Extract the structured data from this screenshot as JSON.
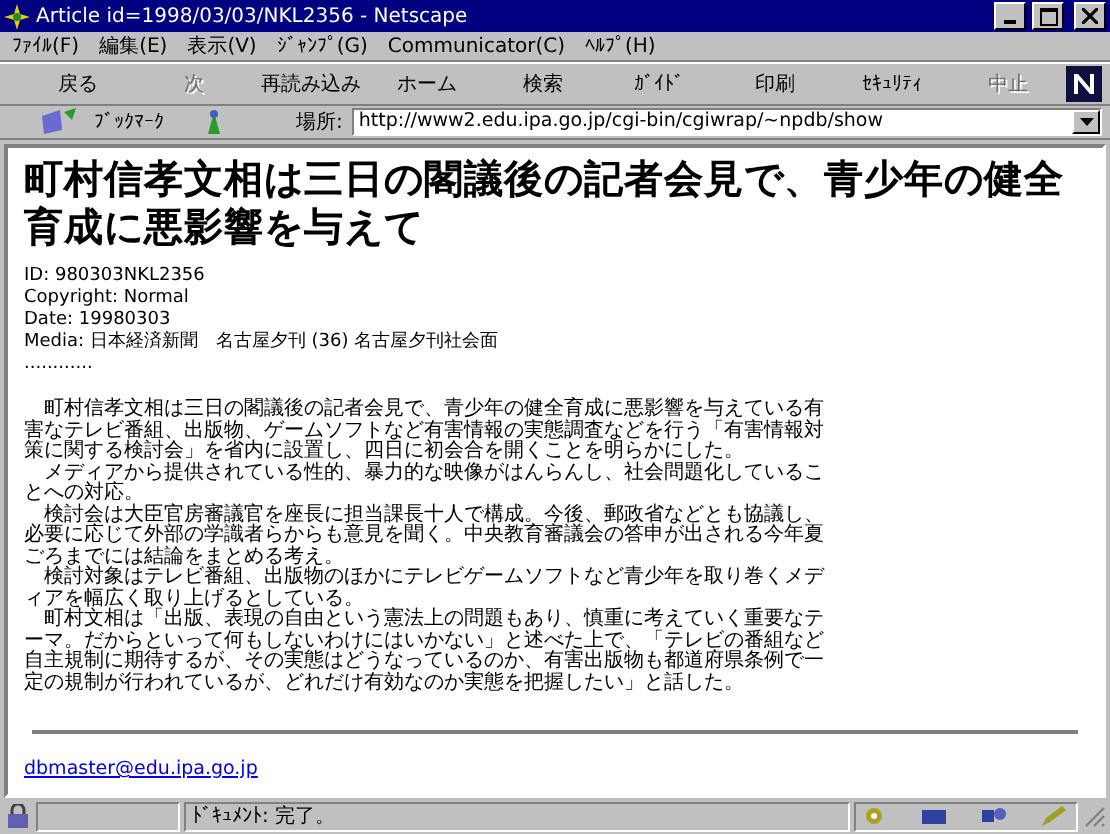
{
  "window": {
    "title": "Article id=1998/03/03/NKL2356 - Netscape"
  },
  "menu": [
    "ﾌｧｲﾙ(F)",
    "編集(E)",
    "表示(V)",
    "ｼﾞｬﾝﾌﾟ(G)",
    "Communicator(C)",
    "ﾍﾙﾌﾟ(H)"
  ],
  "toolbar": [
    {
      "label": "戻る",
      "disabled": false
    },
    {
      "label": "次",
      "disabled": true
    },
    {
      "label": "再読み込み",
      "disabled": false
    },
    {
      "label": "ホーム",
      "disabled": false
    },
    {
      "label": "検索",
      "disabled": false
    },
    {
      "label": "ｶﾞｲﾄﾞ",
      "disabled": false
    },
    {
      "label": "印刷",
      "disabled": false
    },
    {
      "label": "ｾｷｭﾘﾃｨ",
      "disabled": false
    },
    {
      "label": "中止",
      "disabled": true
    }
  ],
  "location_bar": {
    "bookmarks_label": "ﾌﾞｯｸﾏｰｸ",
    "location_label": "場所:",
    "url": "http://www2.edu.ipa.go.jp/cgi-bin/cgiwrap/~npdb/show"
  },
  "article": {
    "title": "町村信孝文相は三日の閣議後の記者会見で、青少年の健全育成に悪影響を与えて",
    "meta": [
      "ID: 980303NKL2356",
      "Copyright: Normal",
      "Date: 19980303",
      "Media: 日本経済新聞　名古屋夕刊 (36) 名古屋夕刊社会面",
      "............"
    ],
    "body_lines": [
      "　町村信孝文相は三日の閣議後の記者会見で、青少年の健全育成に悪影響を与えている有",
      "害なテレビ番組、出版物、ゲームソフトなど有害情報の実態調査などを行う「有害情報対",
      "策に関する検討会」を省内に設置し、四日に初会合を開くことを明らかにした。",
      "　メディアから提供されている性的、暴力的な映像がはんらんし、社会問題化しているこ",
      "とへの対応。",
      "　検討会は大臣官房審議官を座長に担当課長十人で構成。今後、郵政省などとも協議し、",
      "必要に応じて外部の学識者らからも意見を聞く。中央教育審議会の答申が出される今年夏",
      "ごろまでには結論をまとめる考え。",
      "　検討対象はテレビ番組、出版物のほかにテレビゲームソフトなど青少年を取り巻くメデ",
      "ィアを幅広く取り上げるとしている。",
      "　町村文相は「出版、表現の自由という憲法上の問題もあり、慎重に考えていく重要なテ",
      "ーマ。だからといって何もしないわけにはいかない」と述べた上で、「テレビの番組など",
      "自主規制に期待するが、その実態はどうなっているのか、有害出版物も都道府県条例で一",
      "定の規制が行われているが、どれだけ有効なのか実態を把握したい」と話した。"
    ],
    "contact_email": "dbmaster@edu.ipa.go.jp"
  },
  "status_bar": {
    "text": "ﾄﾞｷｭﾒﾝﾄ: 完了。"
  }
}
